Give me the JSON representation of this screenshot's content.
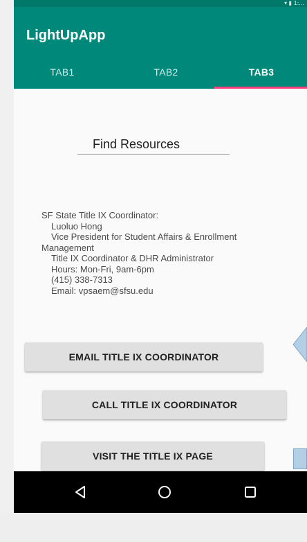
{
  "status_bar": {
    "icons": "▾ ▮ 1:..."
  },
  "app_bar": {
    "title": "LightUpApp",
    "tabs": [
      {
        "label": "TAB1",
        "active": false
      },
      {
        "label": "TAB2",
        "active": false
      },
      {
        "label": "TAB3",
        "active": true
      }
    ],
    "accent_color": "#ff4081",
    "primary_color": "#00897b"
  },
  "content": {
    "find_field": {
      "value": "Find Resources"
    },
    "info": {
      "lines": [
        "SF State Title IX Coordinator:",
        "Luoluo Hong",
        "Vice President for Student Affairs & Enrollment",
        "Management",
        "Title IX Coordinator & DHR Administrator",
        "Hours: Mon-Fri, 9am-6pm",
        "(415) 338-7313",
        "Email: vpsaem@sfsu.edu"
      ]
    },
    "buttons": {
      "email": "EMAIL TITLE IX COORDINATOR",
      "call": "CALL TITLE IX COORDINATOR",
      "visit": "VISIT THE TITLE IX PAGE"
    }
  },
  "nav_bar": {
    "back_icon": "back-triangle-icon",
    "home_icon": "home-circle-icon",
    "recent_icon": "recent-square-icon"
  }
}
